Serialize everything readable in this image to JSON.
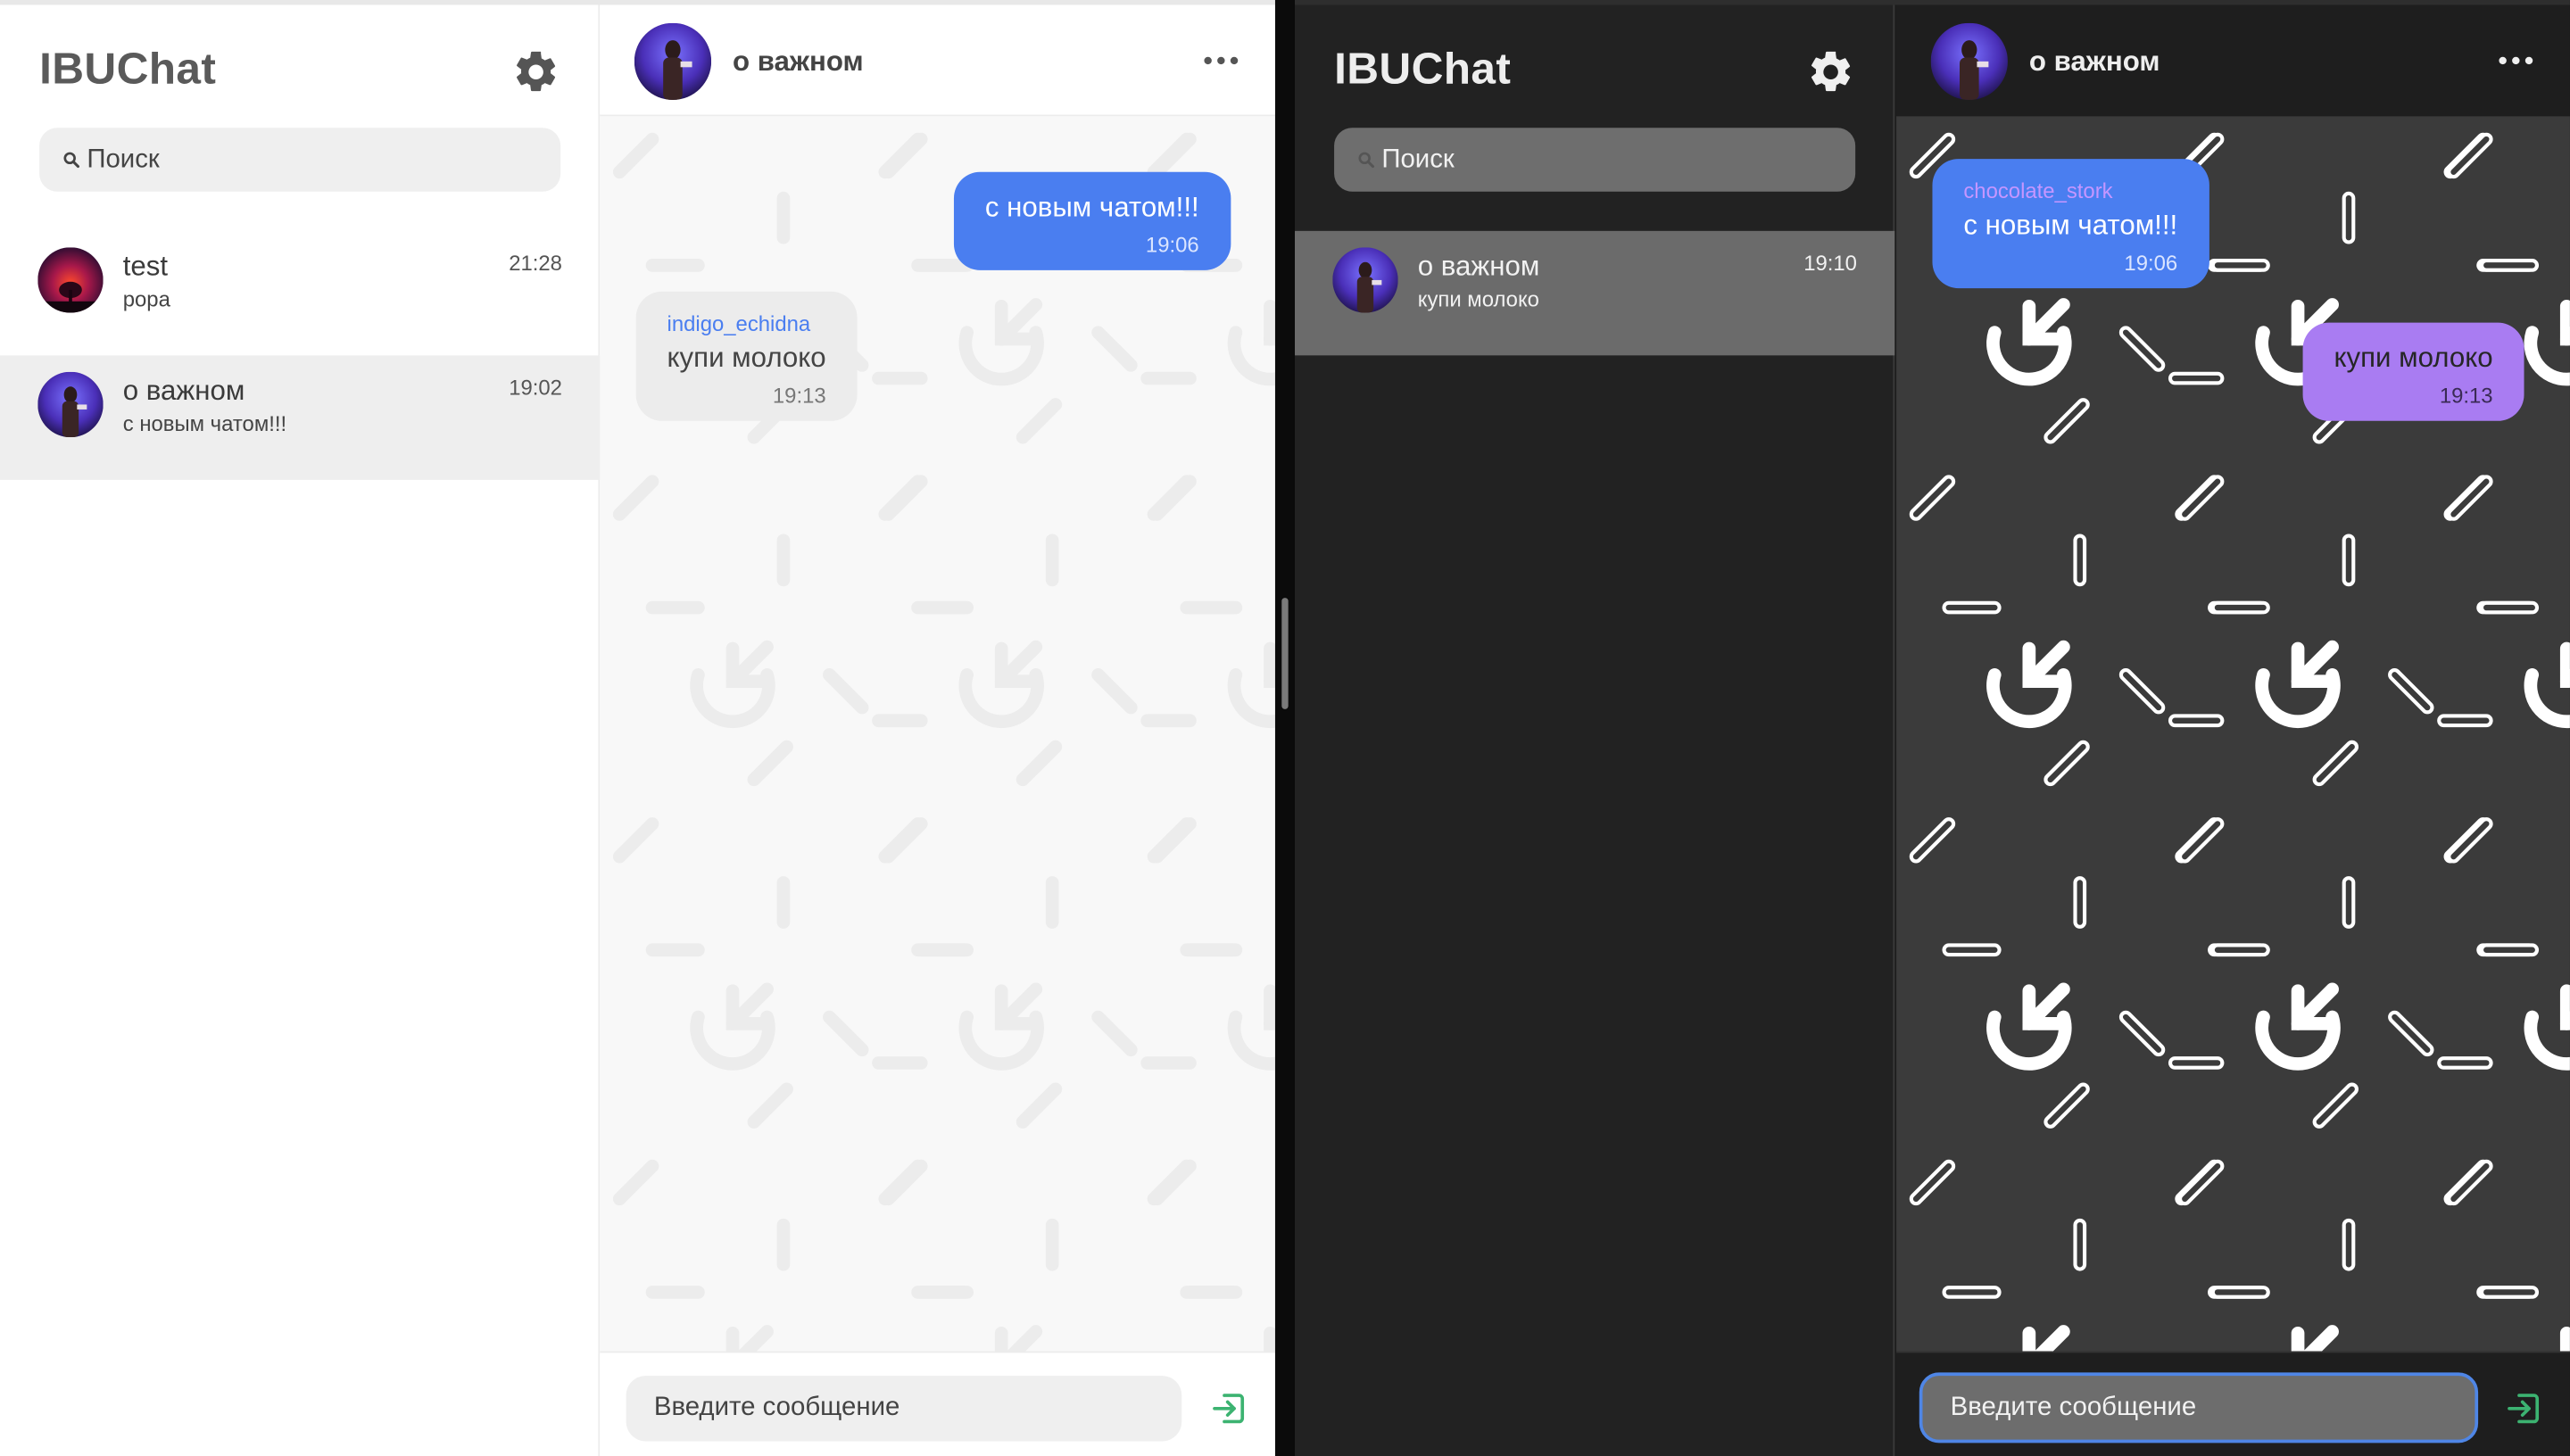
{
  "app": {
    "title": "IBUChat",
    "search_placeholder": "Поиск",
    "composer_placeholder": "Введите сообщение"
  },
  "icons": {
    "settings": "gear-icon",
    "search": "search-icon",
    "more": "more-dots-icon",
    "send": "send-icon"
  },
  "colors": {
    "own_bubble": "#4a7ef0",
    "other_bubble_dark": "#a97cf2",
    "other_bubble_light": "#ececec",
    "sender_light": "#4a7ef0",
    "sender_dark": "#c596ff",
    "focus_ring": "#4f86e6"
  },
  "light": {
    "chats": [
      {
        "name": "test",
        "preview": "popa",
        "time": "21:28"
      },
      {
        "name": "о важном",
        "preview": "с новым чатом!!!",
        "time": "19:02"
      }
    ],
    "header": {
      "title": "о важном"
    },
    "messages": [
      {
        "text": "с новым чатом!!!",
        "time": "19:06",
        "own": true
      },
      {
        "sender": "indigo_echidna",
        "text": "купи молоко",
        "time": "19:13",
        "own": false
      }
    ]
  },
  "dark": {
    "chats": [
      {
        "name": "о важном",
        "preview": "купи молоко",
        "time": "19:10"
      }
    ],
    "header": {
      "title": "о важном"
    },
    "messages": [
      {
        "sender": "chocolate_stork",
        "text": "с новым чатом!!!",
        "time": "19:06",
        "own": false
      },
      {
        "text": "купи молоко",
        "time": "19:13",
        "own": true
      }
    ]
  }
}
